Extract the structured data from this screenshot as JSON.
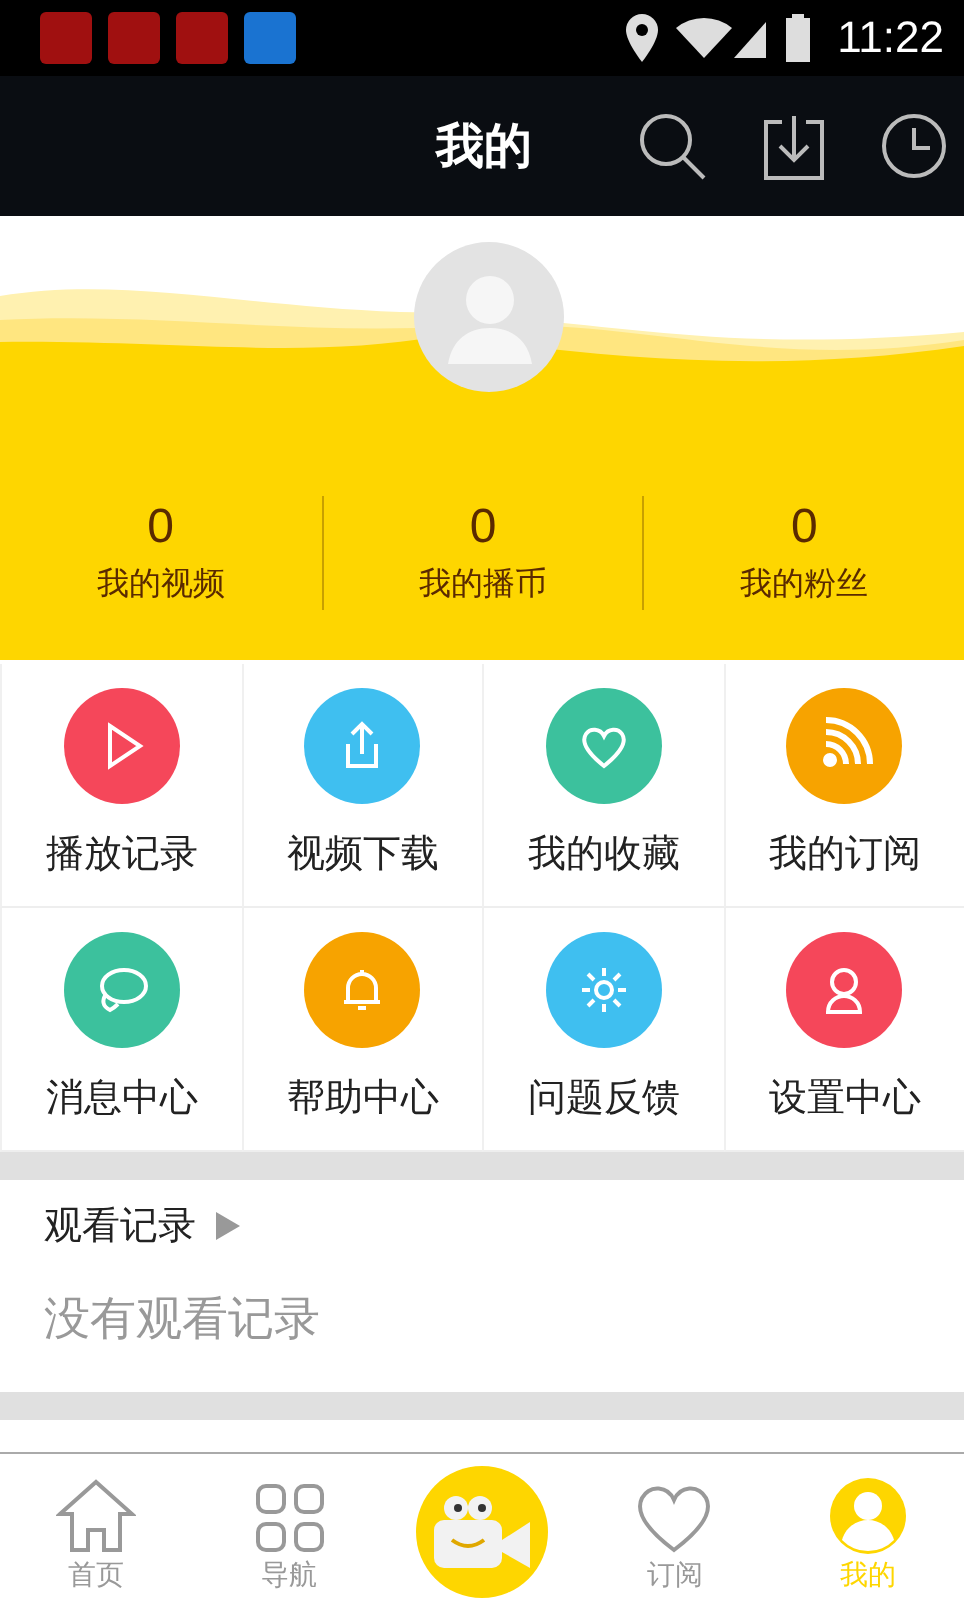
{
  "status_bar": {
    "time": "11:22"
  },
  "header": {
    "title": "我的"
  },
  "stats": [
    {
      "value": "0",
      "label": "我的视频"
    },
    {
      "value": "0",
      "label": "我的播币"
    },
    {
      "value": "0",
      "label": "我的粉丝"
    }
  ],
  "features": [
    {
      "label": "播放记录",
      "kind": "play",
      "color": "#f5475a"
    },
    {
      "label": "视频下载",
      "kind": "share",
      "color": "#3fbff0"
    },
    {
      "label": "我的收藏",
      "kind": "heart",
      "color": "#3cc19d"
    },
    {
      "label": "我的订阅",
      "kind": "rss",
      "color": "#f7a300"
    },
    {
      "label": "消息中心",
      "kind": "chat",
      "color": "#3cc19d"
    },
    {
      "label": "帮助中心",
      "kind": "bell",
      "color": "#f7a300"
    },
    {
      "label": "问题反馈",
      "kind": "gear",
      "color": "#3fbff0"
    },
    {
      "label": "设置中心",
      "kind": "user",
      "color": "#f5475a"
    }
  ],
  "history": {
    "title": "观看记录",
    "empty_text": "没有观看记录"
  },
  "tab_bar": [
    {
      "kind": "home",
      "label": "首页",
      "selected": false
    },
    {
      "kind": "grid",
      "label": "导航",
      "selected": false
    },
    {
      "kind": "camera",
      "selected": false
    },
    {
      "kind": "heart",
      "label": "订阅",
      "selected": false
    },
    {
      "kind": "user",
      "label": "我的",
      "selected": true
    }
  ]
}
